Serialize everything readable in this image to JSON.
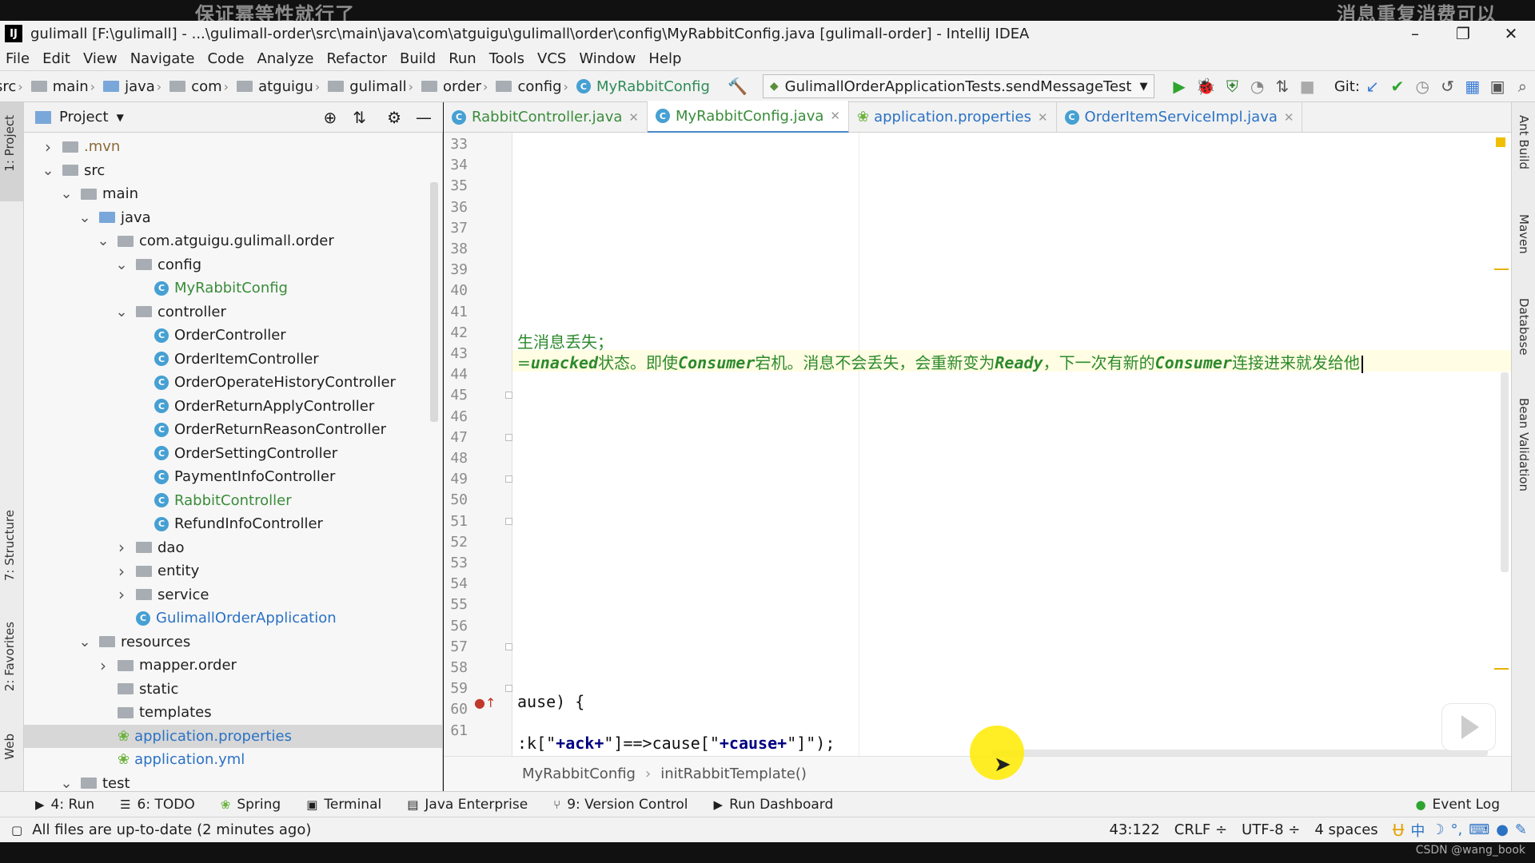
{
  "overlay": {
    "top_left": "保证幂等性就行了",
    "top_right": "消息重复消费可以",
    "watermark": "CSDN @wang_book"
  },
  "window": {
    "logo": "IJ",
    "title": "gulimall [F:\\gulimall] - ...\\gulimall-order\\src\\main\\java\\com\\atguigu\\gulimall\\order\\config\\MyRabbitConfig.java [gulimall-order] - IntelliJ IDEA"
  },
  "menu": [
    "File",
    "Edit",
    "View",
    "Navigate",
    "Code",
    "Analyze",
    "Refactor",
    "Build",
    "Run",
    "Tools",
    "VCS",
    "Window",
    "Help"
  ],
  "nav": {
    "crumbs": [
      "src",
      "main",
      "java",
      "com",
      "atguigu",
      "gulimall",
      "order",
      "config"
    ],
    "current": "MyRabbitConfig",
    "run_config": "GulimallOrderApplicationTests.sendMessageTest",
    "git_label": "Git:"
  },
  "left_tabs": {
    "project": "1: Project",
    "structure": "7: Structure",
    "favorites": "2: Favorites",
    "web": "Web"
  },
  "project": {
    "title": "Project",
    "tree": [
      {
        "label": ".mvn",
        "depth": 1,
        "state": "collapsed",
        "kind": "folder"
      },
      {
        "label": "src",
        "depth": 1,
        "state": "expanded",
        "kind": "folder"
      },
      {
        "label": "main",
        "depth": 2,
        "state": "expanded",
        "kind": "folder"
      },
      {
        "label": "java",
        "depth": 3,
        "state": "expanded",
        "kind": "folder-blue"
      },
      {
        "label": "com.atguigu.gulimall.order",
        "depth": 4,
        "state": "expanded",
        "kind": "folder"
      },
      {
        "label": "config",
        "depth": 5,
        "state": "expanded",
        "kind": "folder"
      },
      {
        "label": "MyRabbitConfig",
        "depth": 6,
        "state": "leaf",
        "kind": "class-green"
      },
      {
        "label": "controller",
        "depth": 5,
        "state": "expanded",
        "kind": "folder"
      },
      {
        "label": "OrderController",
        "depth": 6,
        "state": "leaf",
        "kind": "class"
      },
      {
        "label": "OrderItemController",
        "depth": 6,
        "state": "leaf",
        "kind": "class"
      },
      {
        "label": "OrderOperateHistoryController",
        "depth": 6,
        "state": "leaf",
        "kind": "class"
      },
      {
        "label": "OrderReturnApplyController",
        "depth": 6,
        "state": "leaf",
        "kind": "class"
      },
      {
        "label": "OrderReturnReasonController",
        "depth": 6,
        "state": "leaf",
        "kind": "class"
      },
      {
        "label": "OrderSettingController",
        "depth": 6,
        "state": "leaf",
        "kind": "class"
      },
      {
        "label": "PaymentInfoController",
        "depth": 6,
        "state": "leaf",
        "kind": "class"
      },
      {
        "label": "RabbitController",
        "depth": 6,
        "state": "leaf",
        "kind": "class-green"
      },
      {
        "label": "RefundInfoController",
        "depth": 6,
        "state": "leaf",
        "kind": "class"
      },
      {
        "label": "dao",
        "depth": 5,
        "state": "collapsed",
        "kind": "folder"
      },
      {
        "label": "entity",
        "depth": 5,
        "state": "collapsed",
        "kind": "folder"
      },
      {
        "label": "service",
        "depth": 5,
        "state": "collapsed",
        "kind": "folder"
      },
      {
        "label": "GulimallOrderApplication",
        "depth": 5,
        "state": "leaf",
        "kind": "app"
      },
      {
        "label": "resources",
        "depth": 3,
        "state": "expanded",
        "kind": "folder"
      },
      {
        "label": "mapper.order",
        "depth": 4,
        "state": "collapsed",
        "kind": "folder"
      },
      {
        "label": "static",
        "depth": 4,
        "state": "none",
        "kind": "folder"
      },
      {
        "label": "templates",
        "depth": 4,
        "state": "none",
        "kind": "folder"
      },
      {
        "label": "application.properties",
        "depth": 4,
        "state": "leaf",
        "kind": "props",
        "selected": true
      },
      {
        "label": "application.yml",
        "depth": 4,
        "state": "leaf",
        "kind": "props"
      },
      {
        "label": "test",
        "depth": 2,
        "state": "expanded",
        "kind": "folder"
      }
    ]
  },
  "editor": {
    "tabs": [
      {
        "label": "RabbitController.java",
        "kind": "class"
      },
      {
        "label": "MyRabbitConfig.java",
        "kind": "class",
        "active": true
      },
      {
        "label": "application.properties",
        "kind": "props"
      },
      {
        "label": "OrderItemServiceImpl.java",
        "kind": "class"
      }
    ],
    "line_numbers": [
      "33",
      "34",
      "35",
      "36",
      "37",
      "38",
      "39",
      "40",
      "41",
      "42",
      "43",
      "44",
      "45",
      "46",
      "47",
      "48",
      "49",
      "50",
      "51",
      "52",
      "53",
      "54",
      "55",
      "56",
      "57",
      "58",
      "59",
      "60",
      "61"
    ],
    "line42": "生消息丢失；",
    "line43": {
      "p1": "=",
      "i1": "unacked",
      "p2": "状态。即使",
      "i2": "Consumer",
      "p3": "宕机。消息不会丢失，会重新变为",
      "i3": "Ready",
      "p4": "，下一次有新的",
      "i4": "Consumer",
      "p5": "连接进来就发给他"
    },
    "line59": "ause) {",
    "line61": {
      "a": ":k[\"",
      "b": "+ack+",
      "c": "\"]==>cause[\"",
      "d": "+cause+",
      "e": "\"]\");"
    },
    "breadcrumb": [
      "MyRabbitConfig",
      "initRabbitTemplate()"
    ]
  },
  "right_tabs": [
    "Ant Build",
    "Maven",
    "Database",
    "Bean Validation"
  ],
  "tool_windows": [
    {
      "label": "4: Run",
      "icon": "run-icon"
    },
    {
      "label": "6: TODO",
      "icon": "todo-icon"
    },
    {
      "label": "Spring",
      "icon": "spring-icon"
    },
    {
      "label": "Terminal",
      "icon": "terminal-icon"
    },
    {
      "label": "Java Enterprise",
      "icon": "java-enterprise-icon"
    },
    {
      "label": "9: Version Control",
      "icon": "version-control-icon"
    },
    {
      "label": "Run Dashboard",
      "icon": "run-dashboard-icon"
    }
  ],
  "event_log": "Event Log",
  "status": {
    "message": "All files are up-to-date (2 minutes ago)",
    "position": "43:122",
    "line_sep": "CRLF ÷",
    "encoding": "UTF-8 ÷",
    "indent": "4 spaces",
    "ime": "中"
  }
}
